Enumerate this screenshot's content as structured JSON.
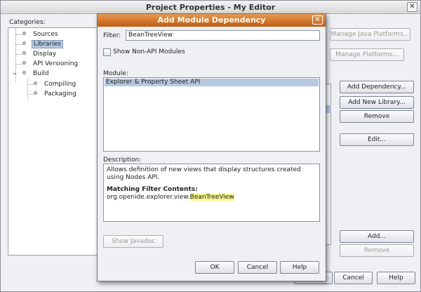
{
  "outer": {
    "title": "Project Properties - My Editor",
    "close_glyph": "✕",
    "categories_label": "Categories:",
    "tree": [
      {
        "label": "Sources",
        "selected": false
      },
      {
        "label": "Libraries",
        "selected": true
      },
      {
        "label": "Display",
        "selected": false
      },
      {
        "label": "API Versioning",
        "selected": false
      },
      {
        "label": "Build",
        "selected": false,
        "expanded": true
      },
      {
        "label": "Compiling",
        "selected": false
      },
      {
        "label": "Packaging",
        "selected": false
      }
    ],
    "buttons": {
      "manage_java_platforms": "Manage Java Platforms...",
      "manage_platforms": "Manage Platforms...",
      "add_dependency": "Add Dependency...",
      "add_new_library": "Add New Library...",
      "remove": "Remove",
      "edit": "Edit...",
      "add": "Add...",
      "remove2": "Remove",
      "ok": "OK",
      "cancel": "Cancel",
      "help": "Help"
    }
  },
  "dialog": {
    "title": "Add Module Dependency",
    "close_glyph": "✕",
    "filter_label": "Filter:",
    "filter_value": "BeanTreeView",
    "show_non_api_label": "Show Non-API Modules",
    "show_non_api_checked": false,
    "module_label": "Module:",
    "modules": [
      "Explorer & Property Sheet API"
    ],
    "description_label": "Description:",
    "description_text": "Allows definition of new views that display structures created using Nodes API.",
    "matching_heading": "Matching Filter Contents:",
    "matching_prefix": "org.openide.explorer.view.",
    "matching_highlight": "BeanTreeView",
    "buttons": {
      "show_javadoc": "Show Javadoc",
      "ok": "OK",
      "cancel": "Cancel",
      "help": "Help"
    }
  },
  "colors": {
    "dialog_title_bar": "#d9782e",
    "selection": "#b6c9e2",
    "highlight": "#f5f58a"
  }
}
